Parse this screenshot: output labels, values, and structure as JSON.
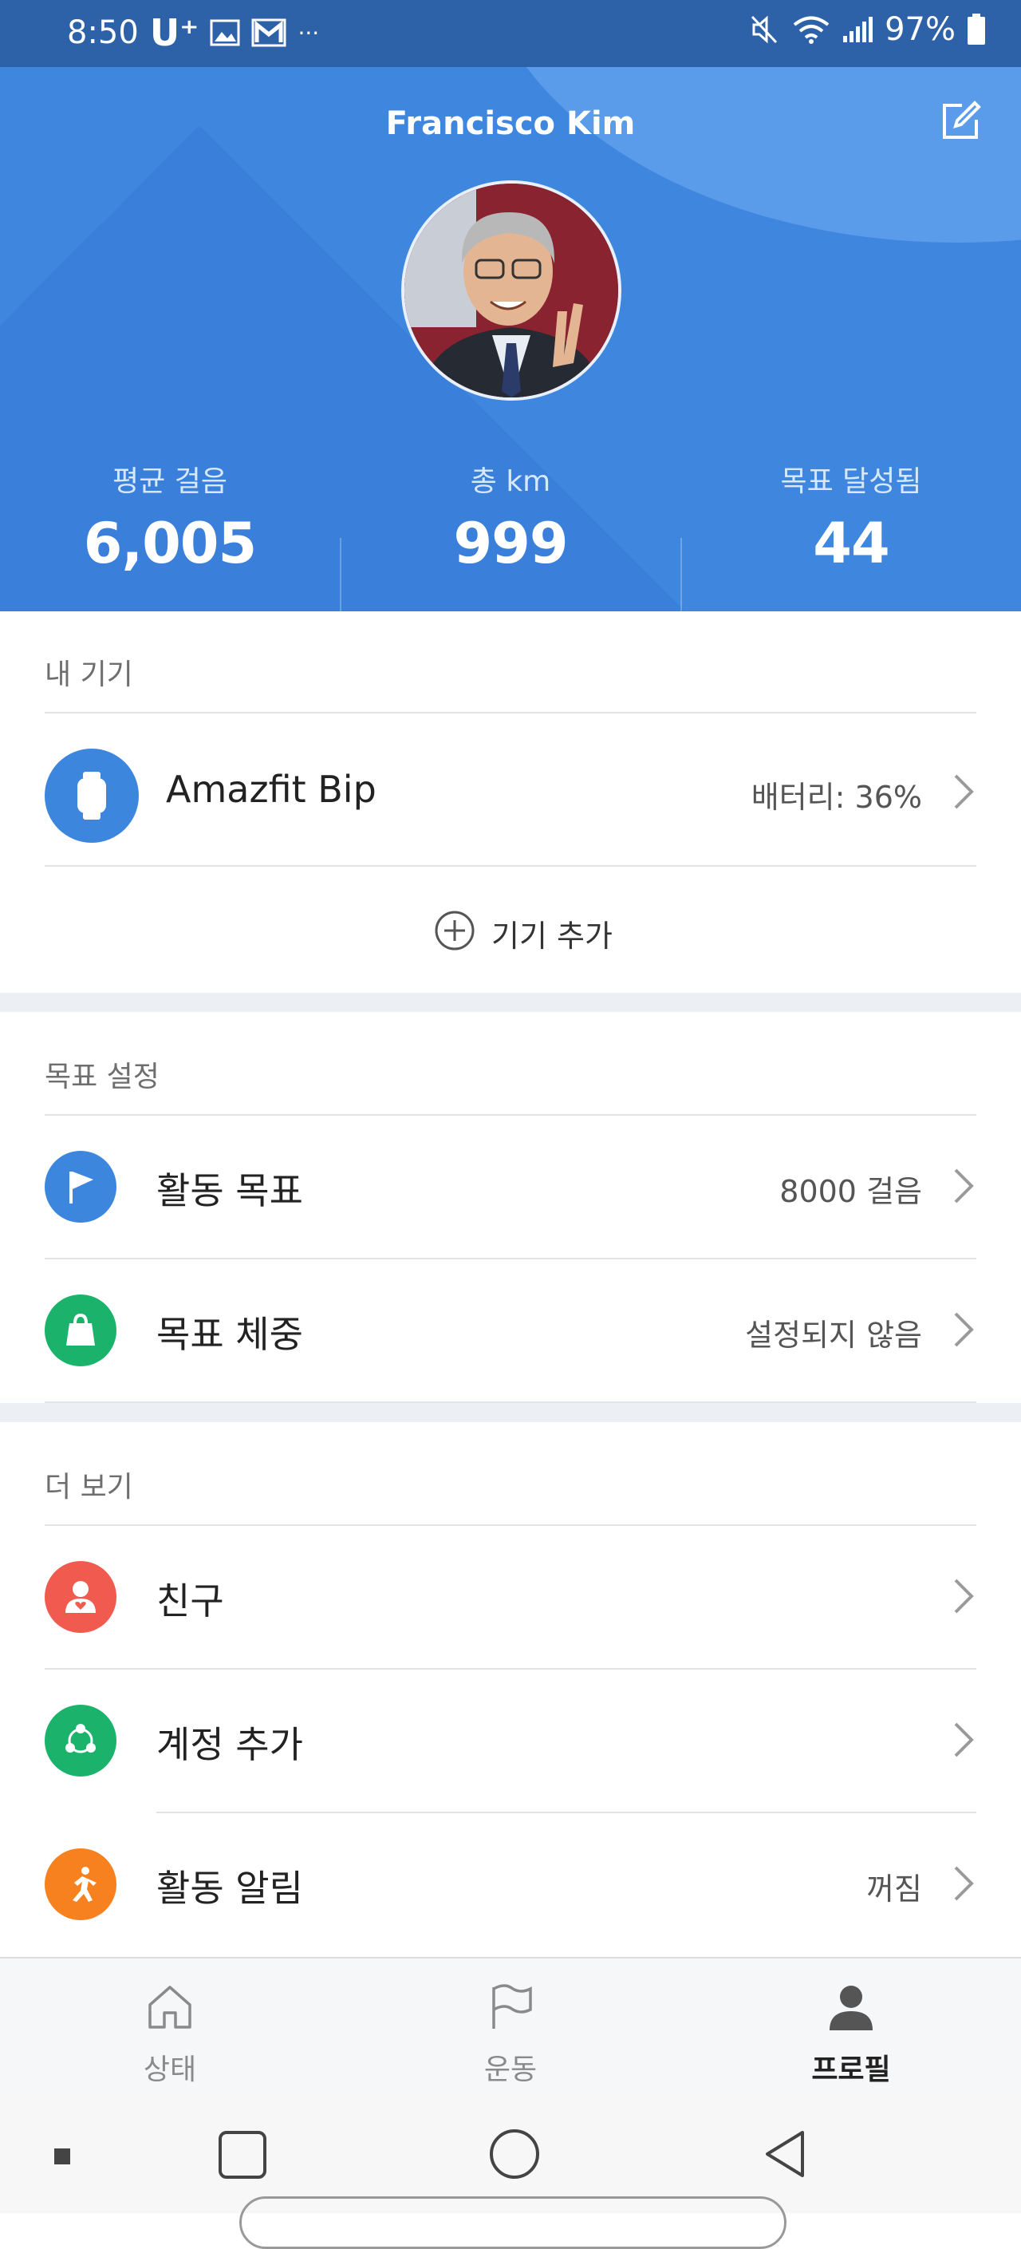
{
  "status_bar": {
    "time": "8:50",
    "carrier": "U⁺",
    "more": "···",
    "battery": "97%"
  },
  "profile": {
    "name": "Francisco Kim",
    "stats": [
      {
        "label": "평균 걸음",
        "value": "6,005"
      },
      {
        "label": "총 km",
        "value": "999"
      },
      {
        "label": "목표 달성됨",
        "value": "44"
      }
    ]
  },
  "devices": {
    "title": "내 기기",
    "device_name": "Amazfit Bip",
    "battery_text": "배터리: 36%",
    "add_label": "기기 추가"
  },
  "goals": {
    "title": "목표 설정",
    "items": [
      {
        "label": "활동 목표",
        "value": "8000 걸음",
        "color": "#3d86de"
      },
      {
        "label": "목표 체중",
        "value": "설정되지 않음",
        "color": "#1bb36b"
      }
    ]
  },
  "more": {
    "title": "더 보기",
    "items": [
      {
        "label": "친구",
        "value": "",
        "color": "#f05a4f"
      },
      {
        "label": "계정 추가",
        "value": "",
        "color": "#1bb36b"
      },
      {
        "label": "활동 알림",
        "value": "꺼짐",
        "color": "#f7811e"
      }
    ]
  },
  "tabs": [
    {
      "label": "상태",
      "active": false
    },
    {
      "label": "운동",
      "active": false
    },
    {
      "label": "프로필",
      "active": true
    }
  ],
  "colors": {
    "header_blue": "#3f86df",
    "status_bar": "#2e62a8",
    "section_gap": "#eceff3"
  }
}
